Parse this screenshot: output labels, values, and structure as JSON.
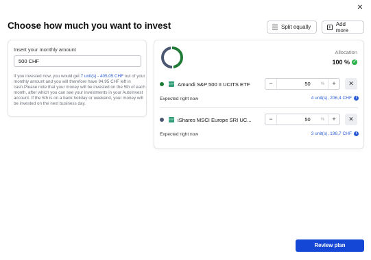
{
  "header": {
    "title": "Choose how much you want to invest",
    "split_label": "Split equally",
    "add_label": "Add more",
    "close_glyph": "✕"
  },
  "amount_card": {
    "label": "Insert your monthly amount",
    "value": "500 CHF",
    "info_pre": "If you invested now, you would get ",
    "info_highlight": "7 unit(s) - 405,05 CHF",
    "info_post": " out of your monthly amount and you will therefore have 94,95 CHF left in cash.Please note that your money will be invested on the 5th of each month, after which you can see your investments in your AutoInvest account. If the 5th is on a bank holiday or weekend, your money will be invested on the next business day."
  },
  "allocation": {
    "label": "Allocation",
    "total": "100 %",
    "donut_colors": [
      "#1f7a35",
      "#4b5670"
    ]
  },
  "holdings": [
    {
      "name": "Amundi S&P 500 II UCITS ETF",
      "color": "#1f7a35",
      "icon_text": "ETF",
      "percent": "50",
      "percent_sign": "%",
      "expected_label": "Expected right now",
      "expected_value": "4 unit(s), 206,4 CHF"
    },
    {
      "name": "iShares MSCI Europe SRI UC...",
      "color": "#4b5670",
      "icon_text": "ETF",
      "percent": "50",
      "percent_sign": "%",
      "expected_label": "Expected right now",
      "expected_value": "3 unit(s), 198,7 CHF"
    }
  ],
  "footer": {
    "review_label": "Review plan"
  }
}
